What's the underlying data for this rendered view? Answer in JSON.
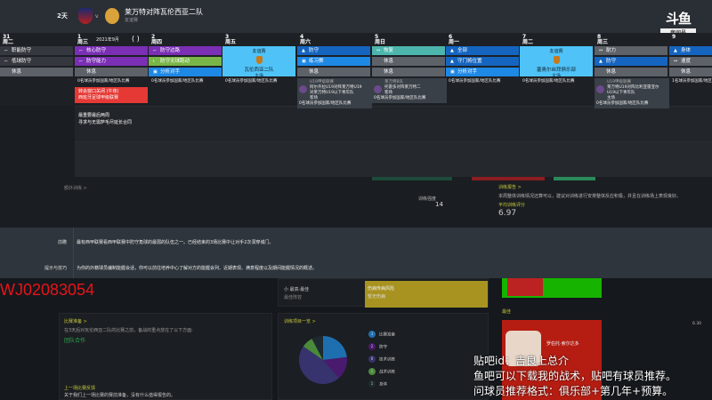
{
  "topbar": {
    "days_left": "2天",
    "vs": "v",
    "match_title": "莱万特对阵瓦伦西亚二队",
    "match_sub": "友谊赛"
  },
  "logo": {
    "brand": "斗鱼",
    "room_label": "房间号",
    "room_id": "10710670"
  },
  "calendar": {
    "month": "2021年9月",
    "days": [
      {
        "num": "31",
        "wd": "周二",
        "sessions": [
          {
            "icon": "⌐",
            "label": "职能防守",
            "color": "#35383e"
          },
          {
            "icon": "⌐",
            "label": "低球防守",
            "color": "#35383e"
          },
          {
            "icon": "",
            "label": "休息",
            "color": "#5d6168"
          }
        ],
        "note": ""
      },
      {
        "num": "1",
        "wd": "周三",
        "sessions": [
          {
            "icon": "⌐",
            "label": "核心防守",
            "color": "#7b2fb5"
          },
          {
            "icon": "⌐",
            "label": "防守能力",
            "color": "#7b2fb5"
          },
          {
            "icon": "",
            "label": "休息",
            "color": "#5d6168"
          }
        ],
        "note": "0名球员参加国家/地区队比赛"
      },
      {
        "num": "2",
        "wd": "周四",
        "sessions": [
          {
            "icon": "⌐",
            "label": "防守边路",
            "color": "#7b2fb5"
          },
          {
            "icon": "ɩ",
            "label": "防守无球跑动",
            "color": "#79b648"
          },
          {
            "icon": "▣",
            "label": "分析对手",
            "color": "#1e88e5"
          }
        ],
        "note": "0名球员参加国家/地区队比赛"
      },
      {
        "num": "3",
        "wd": "周五",
        "match": {
          "type": "友谊赛",
          "opponent": "瓦伦西亚二队",
          "venue": "主场"
        },
        "note": "0名球员参加国家/地区队比赛"
      },
      {
        "num": "4",
        "wd": "周六",
        "sessions": [
          {
            "icon": "▲",
            "label": "防守",
            "color": "#1565c0"
          },
          {
            "icon": "▣",
            "label": "练习赛",
            "color": "#1e88e5"
          },
          {
            "icon": "",
            "label": "休息",
            "color": "#5d6168"
          }
        ],
        "note": ""
      },
      {
        "num": "5",
        "wd": "周日",
        "sessions": [
          {
            "icon": "↔",
            "label": "恢复",
            "color": "#4db6ac"
          },
          {
            "icon": "",
            "label": "休息",
            "color": "#5d6168"
          },
          {
            "icon": "",
            "label": "休息",
            "color": "#5d6168"
          }
        ],
        "note": ""
      },
      {
        "num": "6",
        "wd": "周一",
        "sessions": [
          {
            "icon": "▲",
            "label": "全部",
            "color": "#1565c0"
          },
          {
            "icon": "▲",
            "label": "守门将位置",
            "color": "#1565c0"
          },
          {
            "icon": "▣",
            "label": "分析对手",
            "color": "#1e88e5"
          }
        ],
        "note": "0名球员参加国家/地区队比赛"
      },
      {
        "num": "7",
        "wd": "周二",
        "match": {
          "type": "友谊赛",
          "opponent": "塞奥尔丝拜俱乐部",
          "venue": "主场"
        },
        "note": "0名球员参加国家/地区队比赛"
      },
      {
        "num": "8",
        "wd": "周三",
        "sessions": [
          {
            "icon": "↔",
            "label": "耐力",
            "color": "#5d6168"
          },
          {
            "icon": "▲",
            "label": "防守",
            "color": "#1565c0"
          },
          {
            "icon": "",
            "label": "休息",
            "color": "#5d6168"
          }
        ],
        "note": ""
      },
      {
        "num": "9",
        "wd": "",
        "sessions": [
          {
            "icon": "▲",
            "label": "身体",
            "color": "#1565c0"
          },
          {
            "icon": "↔",
            "label": "速度",
            "color": "#5d6168"
          },
          {
            "icon": "",
            "label": "休息",
            "color": "#5d6168"
          }
        ],
        "note": "1名球员参加国家/地区队比赛"
      }
    ]
  },
  "redcard": {
    "title": "转会窗口关闭 (午夜)",
    "sub": "西班牙足球甲级联赛"
  },
  "reminder": {
    "line1": "最重要最后两周",
    "line2": "寻求与无需萨毛尽延长合同"
  },
  "popups": [
    {
      "head": "U19甲级联赛",
      "lines": [
        "阿尔齐拉U19对阵莱万特U19",
        "对莱万特U19以下青年队",
        "客场"
      ],
      "note": "0名球员参加国家/地区队比赛"
    },
    {
      "head": "莱万特B队",
      "lines": [
        "托雷多对阵莱万特二",
        "客场"
      ],
      "note": "0名球员参加国家/地区队比赛"
    },
    {
      "head": "U19甲级联赛",
      "lines": [
        "莱万特U19对阵比利亚雷亚尔",
        "U19以下青年队",
        "主场"
      ],
      "note": "0名球员参加国家/地区队比赛"
    }
  ],
  "mid": {
    "stat_label": "训练强度",
    "stat_value": "14",
    "report_title": "训练报告 >",
    "report_text": "本周整体训练情况还算可以，建议对训练进行安排整体反应积极，并且在训练场上表现良好。",
    "rating_label": "平均训练评分",
    "rating_value": "6.97",
    "link": "额外训练 >"
  },
  "band": {
    "preview_label": "前瞻",
    "preview_text": "最有西甲联赛看西甲联赛中防守角球的最弱的队伍之一。已经结束的3场比赛中让对手2次洞穿城门。",
    "tips_label": "提示与技巧",
    "tips_text": "为你的外籍球员编制能握会话，你可以前往培养中心了解对方的能握会列、近期表现、满意程度以及期间能握情况的概述。"
  },
  "watermark": "WJ02083054",
  "lower": {
    "prep_title": "比赛准备 >",
    "prep_text": "在3天后对瓦伦西亚二队的比赛之前，备战的重点放在了以下方面:",
    "prep_focus": "团队合作",
    "last_title": "上一场比赛反馈",
    "last_text": "关于我们上一场比赛的赛前准备，没有什么值得报告的。",
    "injury_title": "伤病传病风险",
    "injury_sub": "暂无伤病",
    "training_title": "训练项目一览 >",
    "player_name": "罗伯托·索尔达多",
    "player_rating": "6.30",
    "side_title": "最佳",
    "side_head": "小 最高·最佳",
    "side_sub": "最佳阵容"
  },
  "chart_data": {
    "type": "pie",
    "title": "训练项目一览",
    "categories": [
      "比赛准备",
      "防守",
      "技术训练",
      "战术训练",
      "身体"
    ],
    "values": [
      3,
      2,
      6,
      1,
      1
    ],
    "colors": [
      "#1e6fb0",
      "#4a1a6e",
      "#37336e",
      "#4a8a3a",
      "#1e2a30"
    ]
  },
  "legend": [
    {
      "n": "3",
      "label": "比赛准备",
      "color": "#1e6fb0"
    },
    {
      "n": "2",
      "label": "防守",
      "color": "#4a1a6e"
    },
    {
      "n": "6",
      "label": "技术训练",
      "color": "#37336e"
    },
    {
      "n": "1",
      "label": "战术训练",
      "color": "#4a8a3a"
    },
    {
      "n": "1",
      "label": "身体",
      "color": "#1e2a30"
    }
  ],
  "captions": [
    "贴吧id：吉良上总介",
    "鱼吧可以下载我的战术，贴吧有球员推荐。",
    "问球员推荐格式：俱乐部+第几年+预算。"
  ]
}
